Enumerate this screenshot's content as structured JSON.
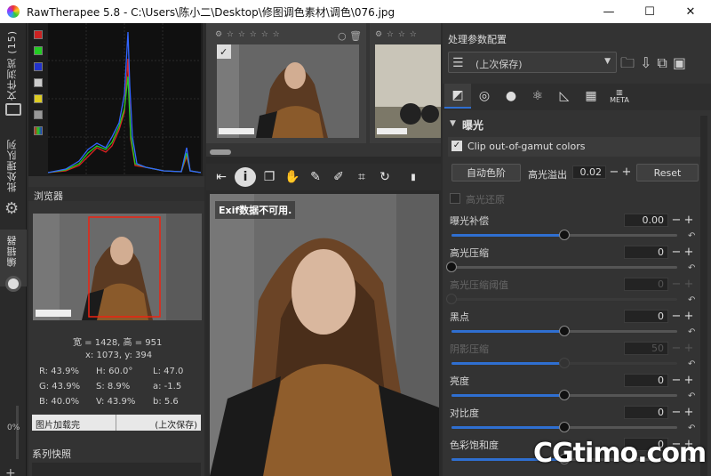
{
  "window": {
    "title": "RawTherapee 5.8 - C:\\Users\\陈小二\\Desktop\\修图调色素材\\调色\\076.jpg"
  },
  "left_tabs": {
    "file_browser": "文件浏览 (15)",
    "batch_queue": "批处理队列",
    "editor": "编辑器"
  },
  "left_panel": {
    "navigator_title": "浏览器",
    "size": "宽 = 1428, 高 = 951",
    "coords": "x: 1073, y: 394",
    "readout": {
      "r": "R:  43.9%",
      "g": "G:  43.9%",
      "b": "B:  40.0%",
      "h": "H:   60.0°",
      "s": "S:    8.9%",
      "v": "V:  43.9%",
      "l": "L:    47.0",
      "a": "a:    -1.5",
      "bb": "b:     5.6"
    },
    "load_status": "图片加载完",
    "profile_state": "(上次保存)",
    "snapshots_title": "系列快照",
    "zoom_pct": "0%"
  },
  "preview": {
    "exif_msg": "Exif数据不可用.",
    "thumb_caption": "WHAT"
  },
  "right_panel": {
    "profile_title": "处理参数配置",
    "profile_value": "(上次保存)",
    "meta_tab": "META",
    "section": "曝光",
    "clip_label": "Clip out-of-gamut colors",
    "auto_levels": "自动色阶",
    "highlight_overflow": "高光溢出",
    "overflow_val": "0.02",
    "reset": "Reset",
    "highlight_recon": "高光还原",
    "sliders": [
      {
        "label": "曝光补偿",
        "value": "0.00",
        "pos": 0.5
      },
      {
        "label": "高光压缩",
        "value": "0",
        "pos": 0.0
      },
      {
        "label": "高光压缩阈值",
        "value": "0",
        "pos": 0.0
      },
      {
        "label": "黑点",
        "value": "0",
        "pos": 0.5
      },
      {
        "label": "阴影压缩",
        "value": "50",
        "pos": 0.5
      },
      {
        "label": "亮度",
        "value": "0",
        "pos": 0.5
      },
      {
        "label": "对比度",
        "value": "0",
        "pos": 0.5
      },
      {
        "label": "色彩饱和度",
        "value": "0",
        "pos": 0.5
      }
    ]
  },
  "watermark": "CGtimo.com"
}
